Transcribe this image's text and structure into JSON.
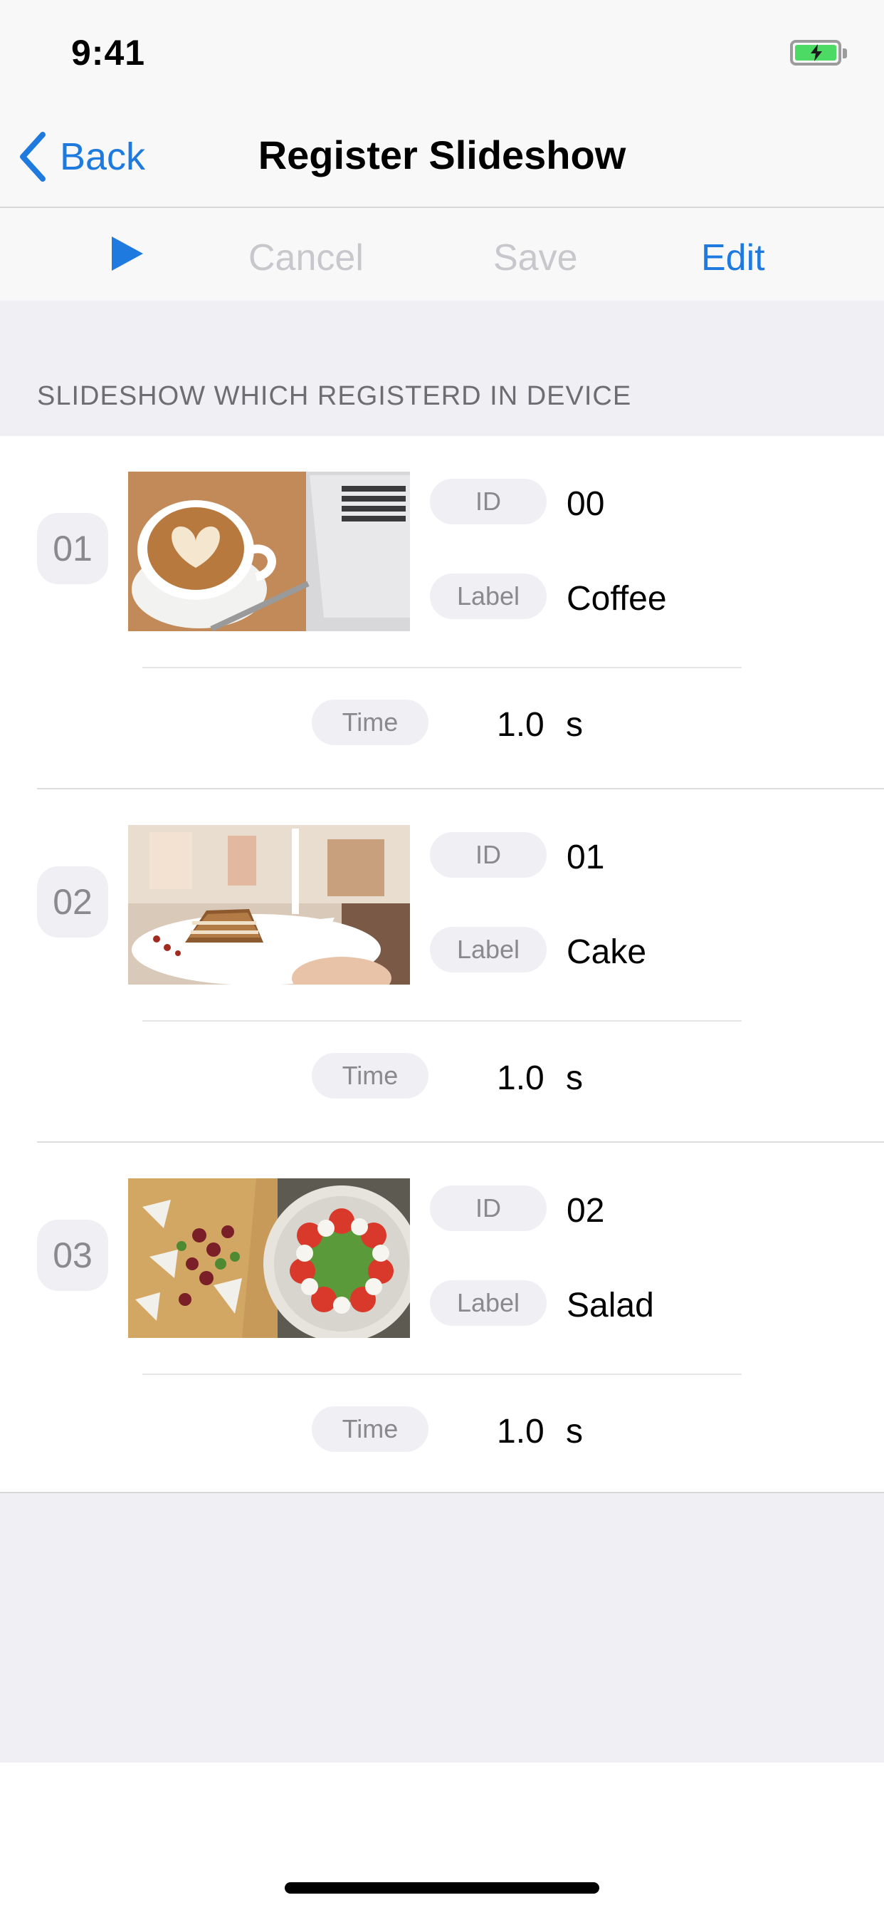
{
  "status_bar": {
    "time": "9:41"
  },
  "nav": {
    "back_label": "Back",
    "title": "Register Slideshow"
  },
  "toolbar": {
    "cancel_label": "Cancel",
    "save_label": "Save",
    "edit_label": "Edit",
    "play_icon": "play-icon"
  },
  "section_header": "SLIDESHOW WHICH REGISTERD IN DEVICE",
  "items": [
    {
      "number": "01",
      "id_tag": "ID",
      "id": "00",
      "label_tag": "Label",
      "label": "Coffee",
      "time_tag": "Time",
      "time": "1.0",
      "unit": "s"
    },
    {
      "number": "02",
      "id_tag": "ID",
      "id": "01",
      "label_tag": "Label",
      "label": "Cake",
      "time_tag": "Time",
      "time": "1.0",
      "unit": "s"
    },
    {
      "number": "03",
      "id_tag": "ID",
      "id": "02",
      "label_tag": "Label",
      "label": "Salad",
      "time_tag": "Time",
      "time": "1.0",
      "unit": "s"
    }
  ],
  "colors": {
    "accent": "#1f7ae0",
    "disabled": "#c7c7cc",
    "battery": "#4cd964"
  }
}
